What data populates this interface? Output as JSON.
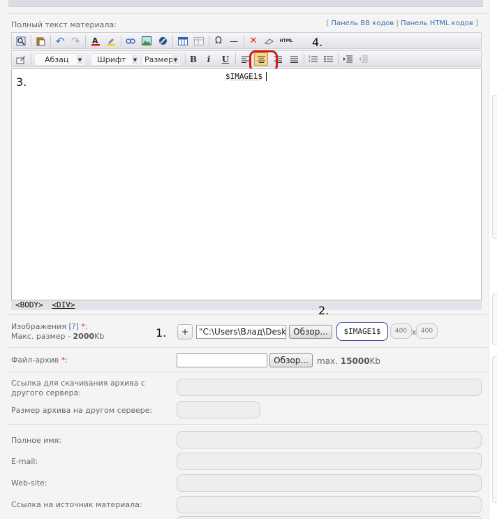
{
  "editor": {
    "label": "Полный текст материала:",
    "panel_links": {
      "open": "[",
      "bb": "Панель BB кодов",
      "sep": "|",
      "html": "Панель HTML кодов",
      "close": "]"
    },
    "toolbar1": [
      {
        "name": "find-icon",
        "glyph": "🔍"
      },
      {
        "name": "paste-icon",
        "glyph": "📋"
      },
      {
        "name": "undo-icon",
        "glyph": "↶"
      },
      {
        "name": "redo-icon",
        "glyph": "↷"
      },
      {
        "name": "text-color-icon",
        "glyph": "A"
      },
      {
        "name": "highlight-icon",
        "glyph": "✎"
      },
      {
        "name": "link-icon",
        "glyph": "∞"
      },
      {
        "name": "image-icon",
        "glyph": "▣"
      },
      {
        "name": "unlink-icon",
        "glyph": "⊘"
      },
      {
        "name": "table-icon",
        "glyph": "▦"
      },
      {
        "name": "edit-table-icon",
        "glyph": "▤"
      },
      {
        "name": "special-char-icon",
        "glyph": "Ω"
      },
      {
        "name": "horizontal-rule-icon",
        "glyph": "—"
      },
      {
        "name": "remove-format-icon",
        "glyph": "✕"
      },
      {
        "name": "eraser-icon",
        "glyph": "⌫"
      },
      {
        "name": "html-source-icon",
        "glyph": "HTML"
      }
    ],
    "toolbar2": {
      "format_label": "Абзац",
      "font_label": "Шрифт",
      "size_label": "Размер",
      "bold": "B",
      "italic": "i",
      "underline": "U"
    },
    "content": "$IMAGE1$",
    "statusbar": {
      "body": "<BODY>",
      "div": "<DIV>"
    }
  },
  "annotations": {
    "n1": "1.",
    "n2": "2.",
    "n3": "3.",
    "n4": "4."
  },
  "images": {
    "label": "Изображения",
    "help": "[?]",
    "required": "*",
    "colon": ":",
    "max_prefix": "Макс. размер -",
    "max_value": "2000",
    "max_unit": "Kb",
    "add_label": "+",
    "file_value": "\"C:\\Users\\Влад\\Deskto",
    "browse_label": "Обзор...",
    "tag": "$IMAGE1$",
    "width": "400",
    "height": "400",
    "x": "x"
  },
  "archive": {
    "label": "Файл-архив",
    "required": "*",
    "colon": ":",
    "browse_label": "Обзор...",
    "max_prefix": "max.",
    "max_value": "15000",
    "max_unit": "Kb"
  },
  "form": {
    "download_link_label": "Ссылка для скачивания архива с другого сервера:",
    "archive_size_label": "Размер архива на другом сервере:",
    "full_name_label": "Полное имя:",
    "email_label": "E-mail:",
    "website_label": "Web-site:",
    "source_label": "Ссылка на источник материала:"
  }
}
